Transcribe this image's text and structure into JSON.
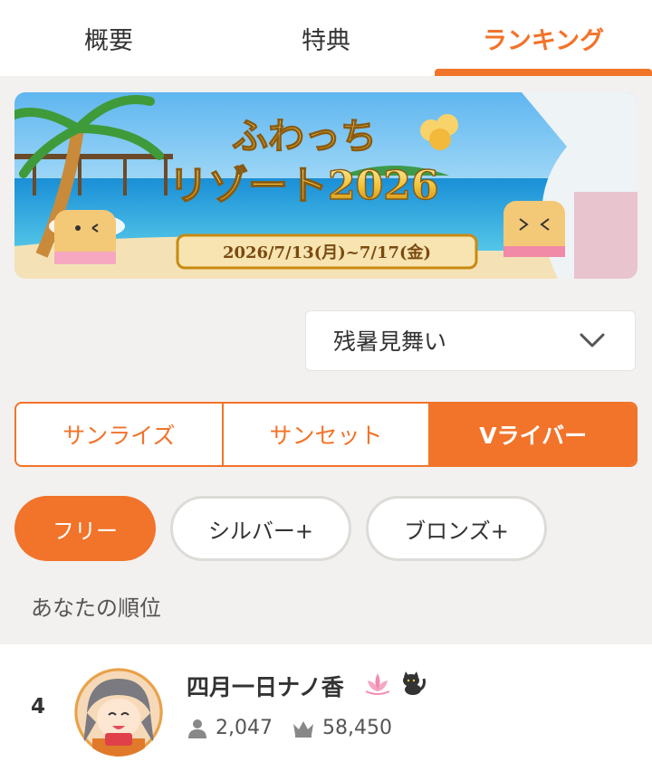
{
  "tabs": [
    {
      "label": "概要",
      "active": false
    },
    {
      "label": "特典",
      "active": false
    },
    {
      "label": "ランキング",
      "active": true
    }
  ],
  "accent_color": "#f2732a",
  "banner": {
    "title_line1": "ふわっち",
    "title_line2": "リゾート2026",
    "dates": "2026/7/13(月)~7/17(金)"
  },
  "dropdown": {
    "selected": "残暑見舞い",
    "icon": "chevron-down-icon"
  },
  "segments": [
    {
      "label": "サンライズ",
      "active": false
    },
    {
      "label": "サンセット",
      "active": false
    },
    {
      "label": "Vライバー",
      "active": true
    }
  ],
  "pills": [
    {
      "label": "フリー",
      "active": true
    },
    {
      "label": "シルバー+",
      "active": false
    },
    {
      "label": "ブロンズ+",
      "active": false
    }
  ],
  "your_rank": {
    "section_title": "あなたの順位",
    "rank": "4",
    "name": "四月一日ナノ香",
    "badges": [
      "lotus-icon",
      "cat-icon"
    ],
    "followers": "2,047",
    "points": "58,450",
    "followers_icon": "person-icon",
    "points_icon": "crown-icon"
  }
}
